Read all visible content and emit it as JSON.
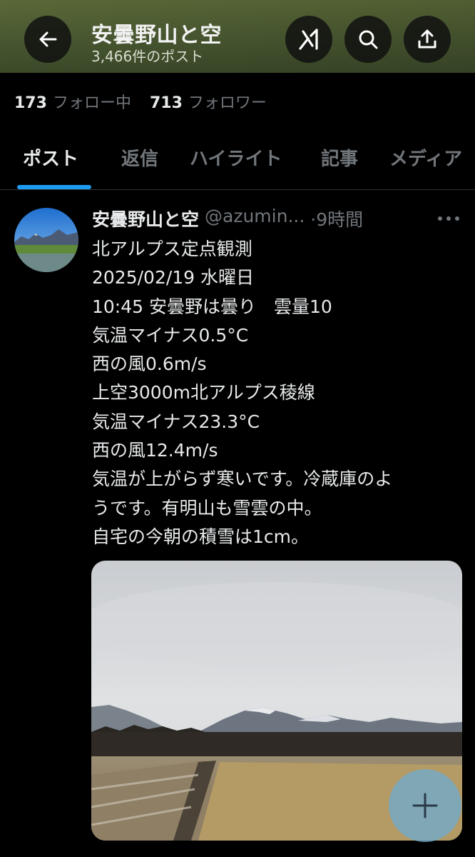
{
  "header": {
    "title": "安曇野山と空",
    "post_count": "3,466件のポスト",
    "icons": [
      "back-arrow-icon",
      "grok-icon",
      "search-icon",
      "share-icon"
    ],
    "background_color": "#55663a"
  },
  "profile": {
    "following_count": "173",
    "following_label": "フォロー中",
    "followers_count": "713",
    "followers_label": "フォロワー"
  },
  "tabs": [
    {
      "label": "ポスト",
      "active": true
    },
    {
      "label": "返信",
      "active": false
    },
    {
      "label": "ハイライト",
      "active": false
    },
    {
      "label": "記事",
      "active": false
    },
    {
      "label": "メディア",
      "active": false
    }
  ],
  "accent_color": "#1d9bf0",
  "post": {
    "author_name": "安曇野山と空",
    "handle": "@azumin...",
    "time": "·9時間",
    "lines": [
      "北アルプス定点観測",
      "2025/02/19 水曜日",
      "10:45 安曇野は曇り　雲量10",
      "気温マイナス0.5°C",
      "西の風0.6m/s",
      "上空3000m北アルプス稜線",
      "気温マイナス23.3°C",
      "西の風12.4m/s",
      "気温が上がらず寒いです。冷蔵庫のよ",
      "うです。有明山も雪雲の中。",
      "自宅の今朝の積雪は1cm。"
    ]
  },
  "fab": {
    "icon": "plus-icon",
    "color": "#70aacd"
  }
}
